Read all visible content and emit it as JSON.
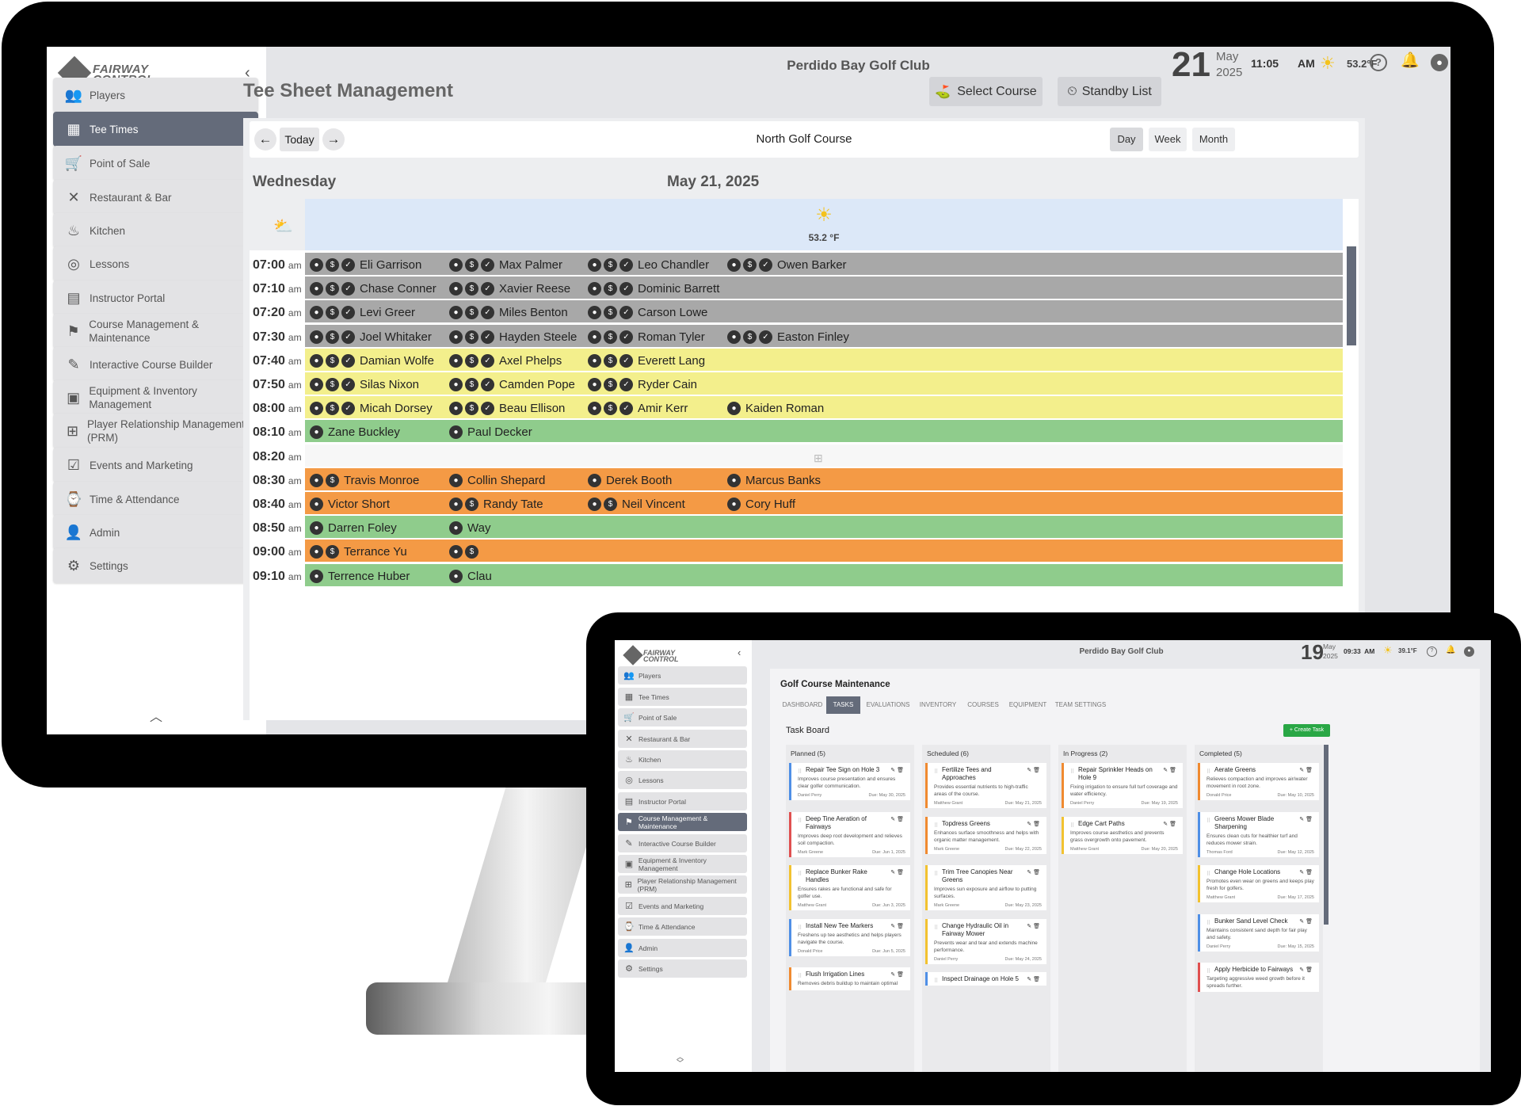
{
  "brand": {
    "line1": "FAIRWAY",
    "line2": "CONTROL"
  },
  "monitor": {
    "club": "Perdido Bay Golf Club",
    "date": {
      "day": "21",
      "month": "May",
      "year": "2025"
    },
    "time": "11:05",
    "ampm": "AM",
    "temperature": "53.2°F",
    "sidebar": [
      {
        "icon": "players-icon",
        "glyph": "👥",
        "label": "Players"
      },
      {
        "icon": "calendar-icon",
        "glyph": "▦",
        "label": "Tee Times",
        "active": true
      },
      {
        "icon": "cart-icon",
        "glyph": "🛒",
        "label": "Point of Sale"
      },
      {
        "icon": "utensils-icon",
        "glyph": "✕",
        "label": "Restaurant & Bar"
      },
      {
        "icon": "kitchen-icon",
        "glyph": "♨",
        "label": "Kitchen"
      },
      {
        "icon": "lesson-icon",
        "glyph": "◎",
        "label": "Lessons"
      },
      {
        "icon": "instructor-icon",
        "glyph": "▤",
        "label": "Instructor Portal"
      },
      {
        "icon": "flag-icon",
        "glyph": "⚑",
        "label": "Course Management & Maintenance"
      },
      {
        "icon": "builder-icon",
        "glyph": "✎",
        "label": "Interactive Course Builder"
      },
      {
        "icon": "archive-icon",
        "glyph": "▣",
        "label": "Equipment & Inventory Management"
      },
      {
        "icon": "grid-plus-icon",
        "glyph": "⊞",
        "label": "Player Relationship Management (PRM)"
      },
      {
        "icon": "calendar-check-icon",
        "glyph": "☑",
        "label": "Events and Marketing"
      },
      {
        "icon": "briefcase-clock-icon",
        "glyph": "⌚",
        "label": "Time & Attendance"
      },
      {
        "icon": "admin-icon",
        "glyph": "👤",
        "label": "Admin"
      },
      {
        "icon": "gear-icon",
        "glyph": "⚙",
        "label": "Settings"
      }
    ],
    "page_title": "Tee Sheet Management",
    "select_course": "Select Course",
    "standby_list": "Standby List",
    "today": "Today",
    "course": "North Golf Course",
    "views": [
      "Day",
      "Week",
      "Month"
    ],
    "active_view": "Day",
    "weekday": "Wednesday",
    "full_date": "May 21, 2025",
    "weather_temp": "53.2 °F",
    "colors": {
      "gray": "#a8a8a8",
      "yellow": "#f3ef8c",
      "green": "#8fcc8c",
      "orange": "#f49a45",
      "empty": "#f7f7f7"
    },
    "tee_times": [
      {
        "time": "07:00",
        "ampm": "am",
        "color": "gray",
        "players": [
          {
            "name": "Eli Garrison",
            "badges": 3
          },
          {
            "name": "Max Palmer",
            "badges": 3
          },
          {
            "name": "Leo Chandler",
            "badges": 3
          },
          {
            "name": "Owen Barker",
            "badges": 3
          }
        ]
      },
      {
        "time": "07:10",
        "ampm": "am",
        "color": "gray",
        "players": [
          {
            "name": "Chase Conner",
            "badges": 3
          },
          {
            "name": "Xavier Reese",
            "badges": 3
          },
          {
            "name": "Dominic Barrett",
            "badges": 3
          }
        ]
      },
      {
        "time": "07:20",
        "ampm": "am",
        "color": "gray",
        "players": [
          {
            "name": "Levi Greer",
            "badges": 3
          },
          {
            "name": "Miles Benton",
            "badges": 3
          },
          {
            "name": "Carson Lowe",
            "badges": 3
          }
        ]
      },
      {
        "time": "07:30",
        "ampm": "am",
        "color": "gray",
        "players": [
          {
            "name": "Joel Whitaker",
            "badges": 3
          },
          {
            "name": "Hayden Steele",
            "badges": 3
          },
          {
            "name": "Roman Tyler",
            "badges": 3
          },
          {
            "name": "Easton Finley",
            "badges": 3
          }
        ]
      },
      {
        "time": "07:40",
        "ampm": "am",
        "color": "yellow",
        "players": [
          {
            "name": "Damian Wolfe",
            "badges": 3
          },
          {
            "name": "Axel Phelps",
            "badges": 3
          },
          {
            "name": "Everett Lang",
            "badges": 3
          }
        ]
      },
      {
        "time": "07:50",
        "ampm": "am",
        "color": "yellow",
        "players": [
          {
            "name": "Silas Nixon",
            "badges": 3
          },
          {
            "name": "Camden Pope",
            "badges": 3
          },
          {
            "name": "Ryder Cain",
            "badges": 3
          }
        ]
      },
      {
        "time": "08:00",
        "ampm": "am",
        "color": "yellow",
        "players": [
          {
            "name": "Micah Dorsey",
            "badges": 3
          },
          {
            "name": "Beau Ellison",
            "badges": 3
          },
          {
            "name": "Amir Kerr",
            "badges": 3
          },
          {
            "name": "Kaiden Roman",
            "badges": 1
          }
        ]
      },
      {
        "time": "08:10",
        "ampm": "am",
        "color": "green",
        "players": [
          {
            "name": "Zane Buckley",
            "badges": 1
          },
          {
            "name": "Paul Decker",
            "badges": 1
          }
        ]
      },
      {
        "time": "08:20",
        "ampm": "am",
        "color": "empty",
        "players": []
      },
      {
        "time": "08:30",
        "ampm": "am",
        "color": "orange",
        "players": [
          {
            "name": "Travis Monroe",
            "badges": 2
          },
          {
            "name": "Collin Shepard",
            "badges": 1
          },
          {
            "name": "Derek Booth",
            "badges": 1
          },
          {
            "name": "Marcus Banks",
            "badges": 1
          }
        ]
      },
      {
        "time": "08:40",
        "ampm": "am",
        "color": "orange",
        "players": [
          {
            "name": "Victor Short",
            "badges": 1
          },
          {
            "name": "Randy Tate",
            "badges": 2
          },
          {
            "name": "Neil Vincent",
            "badges": 2
          },
          {
            "name": "Cory Huff",
            "badges": 1
          }
        ]
      },
      {
        "time": "08:50",
        "ampm": "am",
        "color": "green",
        "players": [
          {
            "name": "Darren Foley",
            "badges": 1
          },
          {
            "name": "Way",
            "badges": 1
          }
        ]
      },
      {
        "time": "09:00",
        "ampm": "am",
        "color": "orange",
        "players": [
          {
            "name": "Terrance Yu",
            "badges": 2
          },
          {
            "name": "",
            "badges": 2
          }
        ]
      },
      {
        "time": "09:10",
        "ampm": "am",
        "color": "green",
        "players": [
          {
            "name": "Terrence Huber",
            "badges": 1
          },
          {
            "name": "Clau",
            "badges": 1
          }
        ]
      }
    ]
  },
  "tablet": {
    "club": "Perdido Bay Golf Club",
    "date": {
      "day": "19",
      "month": "May",
      "year": "2025"
    },
    "time": "09:33",
    "ampm": "AM",
    "temperature": "39.1°F",
    "sidebar": [
      {
        "icon": "players-icon",
        "glyph": "👥",
        "label": "Players"
      },
      {
        "icon": "calendar-icon",
        "glyph": "▦",
        "label": "Tee Times"
      },
      {
        "icon": "cart-icon",
        "glyph": "🛒",
        "label": "Point of Sale"
      },
      {
        "icon": "utensils-icon",
        "glyph": "✕",
        "label": "Restaurant & Bar"
      },
      {
        "icon": "kitchen-icon",
        "glyph": "♨",
        "label": "Kitchen"
      },
      {
        "icon": "lesson-icon",
        "glyph": "◎",
        "label": "Lessons"
      },
      {
        "icon": "instructor-icon",
        "glyph": "▤",
        "label": "Instructor Portal"
      },
      {
        "icon": "flag-icon",
        "glyph": "⚑",
        "label": "Course Management & Maintenance",
        "active": true
      },
      {
        "icon": "builder-icon",
        "glyph": "✎",
        "label": "Interactive Course Builder"
      },
      {
        "icon": "archive-icon",
        "glyph": "▣",
        "label": "Equipment & Inventory Management"
      },
      {
        "icon": "grid-plus-icon",
        "glyph": "⊞",
        "label": "Player Relationship Management (PRM)"
      },
      {
        "icon": "calendar-check-icon",
        "glyph": "☑",
        "label": "Events and Marketing"
      },
      {
        "icon": "briefcase-clock-icon",
        "glyph": "⌚",
        "label": "Time & Attendance"
      },
      {
        "icon": "admin-icon",
        "glyph": "👤",
        "label": "Admin"
      },
      {
        "icon": "gear-icon",
        "glyph": "⚙",
        "label": "Settings"
      }
    ],
    "page_title": "Golf Course Maintenance",
    "tabs": [
      "DASHBOARD",
      "TASKS",
      "EVALUATIONS",
      "INVENTORY",
      "COURSES",
      "EQUIPMENT",
      "TEAM SETTINGS"
    ],
    "active_tab": "TASKS",
    "board_title": "Task Board",
    "create_task": "+ Create Task",
    "columns": [
      {
        "title": "Planned (5)",
        "tasks": [
          {
            "title": "Repair Tee Sign on Hole 3",
            "desc": "Improves course presentation and ensures clear golfer communication.",
            "assignee": "Daniel Perry",
            "due": "Due: May 30, 2025",
            "accent": "#4f8fe6"
          },
          {
            "title": "Deep Tine Aeration of Fairways",
            "desc": "Improves deep root development and relieves soil compaction.",
            "assignee": "Mark Greene",
            "due": "Due: Jun 1, 2025",
            "accent": "#e05050"
          },
          {
            "title": "Replace Bunker Rake Handles",
            "desc": "Ensures rakes are functional and safe for golfer use.",
            "assignee": "Matthew Grant",
            "due": "Due: Jun 3, 2025",
            "accent": "#f2c230"
          },
          {
            "title": "Install New Tee Markers",
            "desc": "Freshens up tee aesthetics and helps players navigate the course.",
            "assignee": "Donald Price",
            "due": "Due: Jun 5, 2025",
            "accent": "#4f8fe6"
          },
          {
            "title": "Flush Irrigation Lines",
            "desc": "Removes debris buildup to maintain optimal",
            "assignee": "",
            "due": "",
            "accent": "#f08a30"
          }
        ]
      },
      {
        "title": "Scheduled (6)",
        "tasks": [
          {
            "title": "Fertilize Tees and Approaches",
            "desc": "Provides essential nutrients to high-traffic areas of the course.",
            "assignee": "Matthew Grant",
            "due": "Due: May 21, 2025",
            "accent": "#f08a30"
          },
          {
            "title": "Topdress Greens",
            "desc": "Enhances surface smoothness and helps with organic matter management.",
            "assignee": "Mark Greene",
            "due": "Due: May 22, 2025",
            "accent": "#f08a30"
          },
          {
            "title": "Trim Tree Canopies Near Greens",
            "desc": "Improves sun exposure and airflow to putting surfaces.",
            "assignee": "Mark Greene",
            "due": "Due: May 23, 2025",
            "accent": "#f2c230"
          },
          {
            "title": "Change Hydraulic Oil in Fairway Mower",
            "desc": "Prevents wear and tear and extends machine performance.",
            "assignee": "Daniel Perry",
            "due": "Due: May 24, 2025",
            "accent": "#f2c230"
          },
          {
            "title": "Inspect Drainage on Hole 5",
            "desc": "",
            "assignee": "",
            "due": "",
            "accent": "#4f8fe6"
          }
        ]
      },
      {
        "title": "In Progress (2)",
        "tasks": [
          {
            "title": "Repair Sprinkler Heads on Hole 9",
            "desc": "Fixing irrigation to ensure full turf coverage and water efficiency.",
            "assignee": "Daniel Perry",
            "due": "Due: May 19, 2025",
            "accent": "#f08a30"
          },
          {
            "title": "Edge Cart Paths",
            "desc": "Improves course aesthetics and prevents grass overgrowth onto pavement.",
            "assignee": "Matthew Grant",
            "due": "Due: May 20, 2025",
            "accent": "#f2c230"
          }
        ]
      },
      {
        "title": "Completed (5)",
        "tasks": [
          {
            "title": "Aerate Greens",
            "desc": "Relieves compaction and improves air/water movement in root zone.",
            "assignee": "Donald Price",
            "due": "Due: May 10, 2025",
            "accent": "#f08a30"
          },
          {
            "title": "Greens Mower Blade Sharpening",
            "desc": "Ensures clean cuts for healthier turf and reduces mower strain.",
            "assignee": "Thomas Ford",
            "due": "Due: May 12, 2025",
            "accent": "#4f8fe6"
          },
          {
            "title": "Change Hole Locations",
            "desc": "Promotes even wear on greens and keeps play fresh for golfers.",
            "assignee": "Matthew Grant",
            "due": "Due: May 17, 2025",
            "accent": "#f2c230"
          },
          {
            "title": "Bunker Sand Level Check",
            "desc": "Maintains consistent sand depth for fair play and safety.",
            "assignee": "Daniel Perry",
            "due": "Due: May 15, 2025",
            "accent": "#4f8fe6"
          },
          {
            "title": "Apply Herbicide to Fairways",
            "desc": "Targeting aggressive weed growth before it spreads further.",
            "assignee": "",
            "due": "",
            "accent": "#e05050"
          }
        ]
      }
    ]
  }
}
